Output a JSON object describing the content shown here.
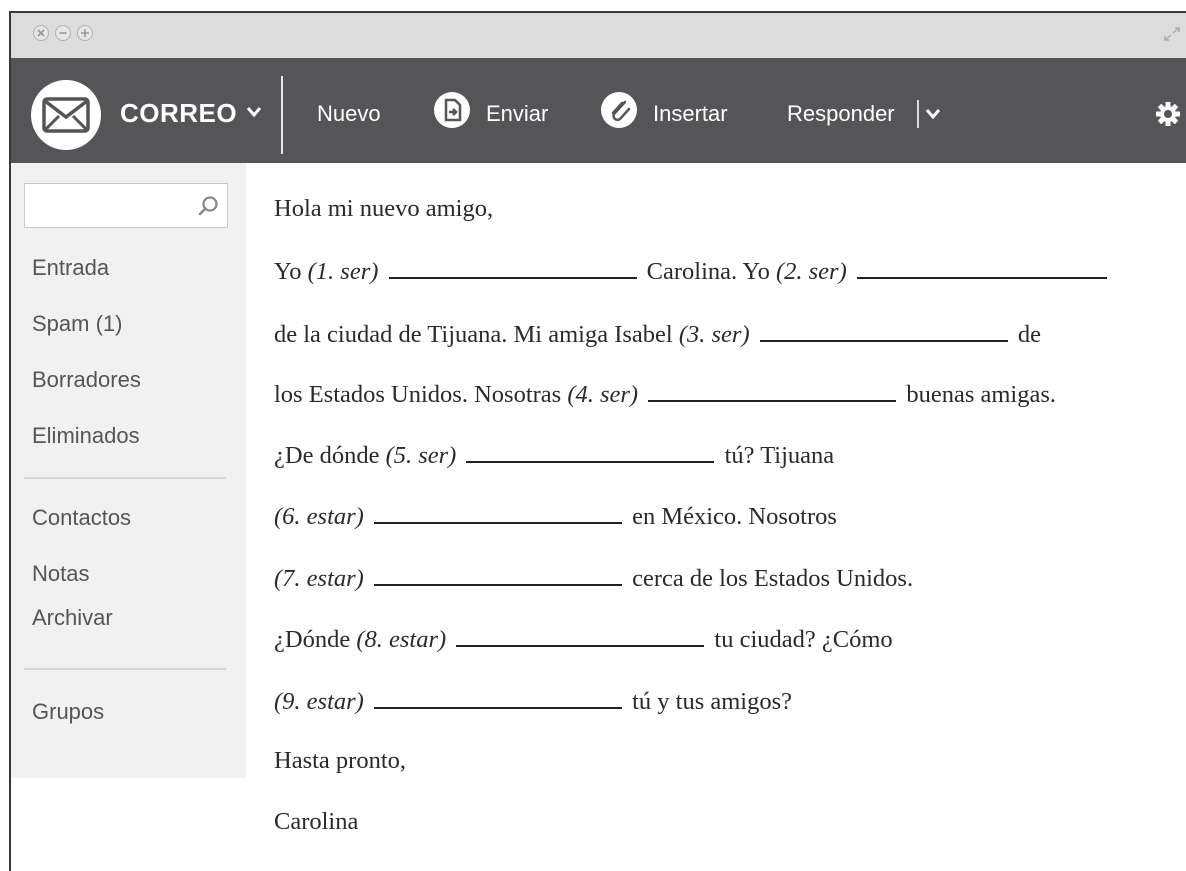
{
  "window": {
    "controls": [
      "close-icon",
      "minimize-icon",
      "maximize-icon"
    ],
    "expand_icon": "expand-icon"
  },
  "toolbar": {
    "app_name": "CORREO",
    "new_label": "Nuevo",
    "send_label": "Enviar",
    "insert_label": "Insertar",
    "reply_label": "Responder",
    "colors": {
      "bar": "#555456",
      "titlebar": "#dcdcdc",
      "sidebar": "#f1f1f1"
    }
  },
  "sidebar": {
    "search": {
      "value": "",
      "placeholder": ""
    },
    "items": [
      "Entrada",
      "Spam (1)",
      "Borradores",
      "Eliminados"
    ],
    "items2": [
      "Contactos",
      "Notas",
      "Archivar"
    ],
    "items3": [
      "Grupos"
    ]
  },
  "email": {
    "greeting": "Hola mi nuevo amigo,",
    "l1": {
      "a": "Yo",
      "c1": "(1. ser)",
      "b": "Carolina. Yo",
      "c2": "(2. ser)"
    },
    "l2": {
      "a": "de la ciudad de Tijuana. Mi amiga Isabel",
      "c": "(3. ser)",
      "b": "de"
    },
    "l3": {
      "a": "los Estados Unidos. Nosotras",
      "c": "(4. ser)",
      "b": "buenas amigas."
    },
    "l4": {
      "a": "¿De dónde",
      "c": "(5. ser)",
      "b": "tú? Tijuana"
    },
    "l5": {
      "c": "(6. estar)",
      "b": "en México. Nosotros"
    },
    "l6": {
      "c": "(7. estar)",
      "b": "cerca de los Estados Unidos."
    },
    "l7": {
      "a": "¿Dónde",
      "c": "(8. estar)",
      "b": "tu ciudad? ¿Cómo"
    },
    "l8": {
      "c": "(9. estar)",
      "b": "tú y tus amigos?"
    },
    "closing": "Hasta pronto,",
    "signature": "Carolina"
  }
}
